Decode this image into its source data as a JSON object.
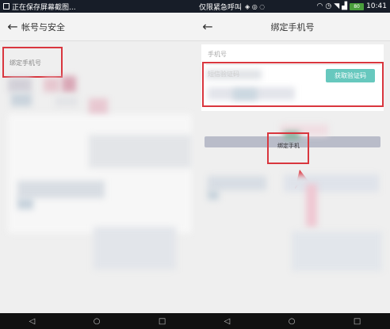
{
  "left_screen": {
    "status_bar": {
      "notification_text": "正在保存屏幕截图..."
    },
    "header": {
      "title": "帐号与安全"
    },
    "section": {
      "label": "绑定手机号"
    },
    "nav_icons": [
      "back-triangle-icon",
      "home-circle-icon",
      "recents-square-icon"
    ]
  },
  "right_screen": {
    "status_bar": {
      "left_text": "仅限紧急呼叫",
      "time": "10:41",
      "battery": "80"
    },
    "header": {
      "title": "绑定手机号"
    },
    "form": {
      "phone_placeholder": "手机号",
      "code_placeholder": "短信验证码",
      "get_code_label": "获取验证码",
      "bind_label": "绑定手机"
    },
    "nav_icons": [
      "back-triangle-icon",
      "home-circle-icon",
      "recents-square-icon"
    ]
  },
  "colors": {
    "statusbar": "#171d28",
    "highlight_red": "#d9363e",
    "teal_button": "#67c8be",
    "bind_button": "#b9bcc9",
    "arrow_red": "#e0242e"
  }
}
